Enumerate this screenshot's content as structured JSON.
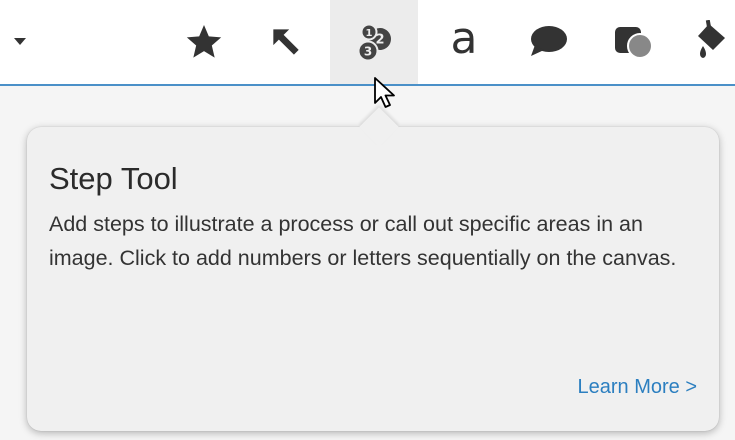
{
  "toolbar": {
    "tools": [
      {
        "name": "favorites",
        "icon": "star-icon"
      },
      {
        "name": "arrow",
        "icon": "arrow-icon"
      },
      {
        "name": "step",
        "icon": "step-icon",
        "selected": true
      },
      {
        "name": "text",
        "icon": "text-icon",
        "glyph": "a"
      },
      {
        "name": "callout",
        "icon": "speech-bubble-icon"
      },
      {
        "name": "shape",
        "icon": "shape-icon"
      },
      {
        "name": "fill",
        "icon": "fill-bucket-icon"
      }
    ],
    "colors": {
      "border": "#4a90c8",
      "selected_bg": "#ececec",
      "icon": "#333333"
    }
  },
  "tooltip": {
    "title": "Step Tool",
    "description": "Add steps to illustrate a process or call out specific areas in an image. Click to add numbers or letters sequentially on the canvas.",
    "link_label": "Learn More >",
    "link_color": "#2c7fc0"
  }
}
